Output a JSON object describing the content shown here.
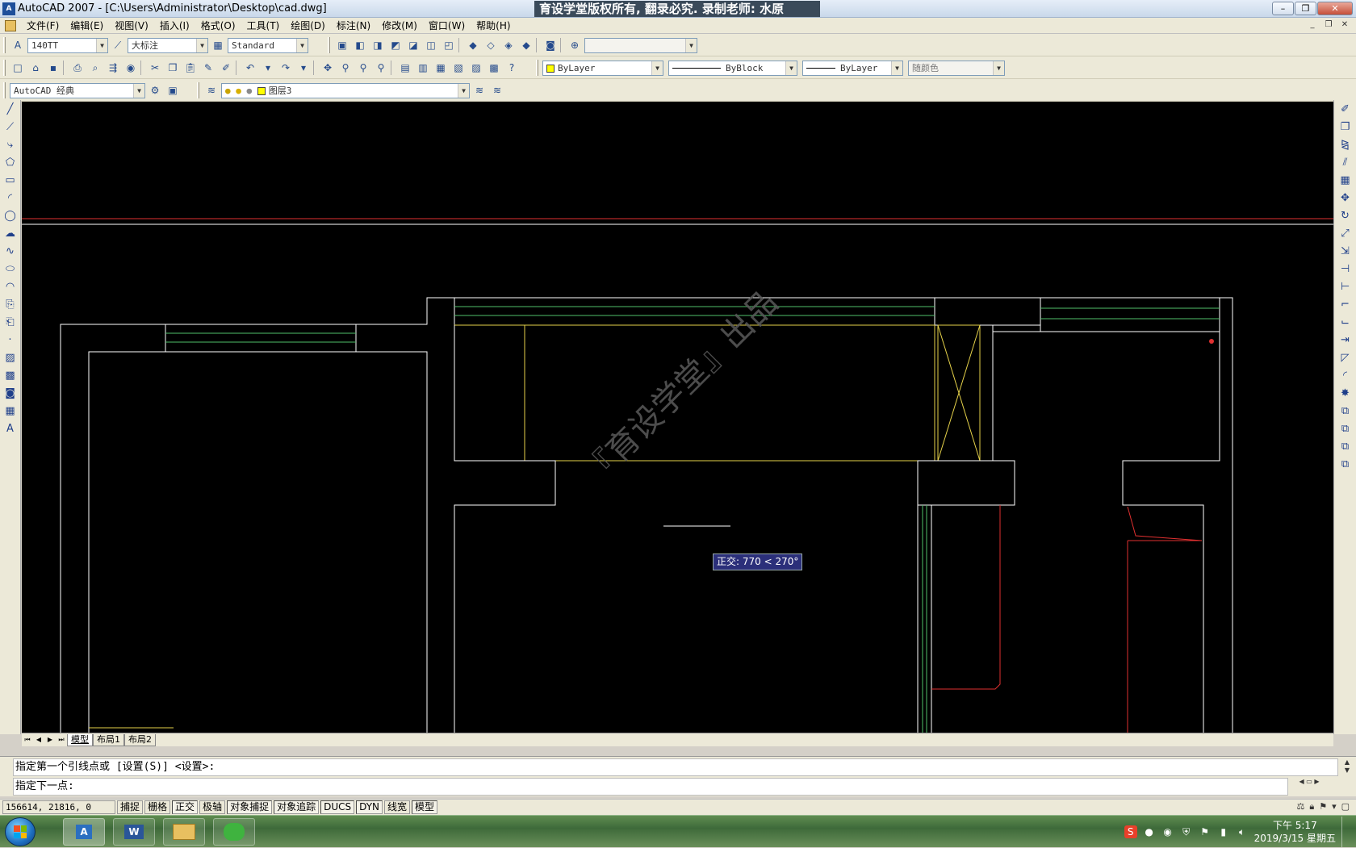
{
  "window": {
    "title": "AutoCAD 2007 - [C:\\Users\\Administrator\\Desktop\\cad.dwg]",
    "banner": "育设学堂版权所有, 翻录必究. 录制老师: 水原",
    "app_icon": "A"
  },
  "menu": [
    "文件(F)",
    "编辑(E)",
    "视图(V)",
    "插入(I)",
    "格式(O)",
    "工具(T)",
    "绘图(D)",
    "标注(N)",
    "修改(M)",
    "窗口(W)",
    "帮助(H)"
  ],
  "toolbar1": {
    "text_style": "140TT",
    "dim_style": "大标注",
    "table_style": "Standard",
    "named_view": ""
  },
  "toolbar2": {
    "color": "ByLayer",
    "linetype": "ByBlock",
    "lineweight": "ByLayer",
    "plotstyle": "随颜色"
  },
  "toolbar3": {
    "workspace": "AutoCAD 经典",
    "layer": "图层3"
  },
  "drawing": {
    "tooltip": "正交: 770 < 270°",
    "watermark": "『育设学堂』出品"
  },
  "layout_tabs": [
    "模型",
    "布局1",
    "布局2"
  ],
  "command": {
    "history": "指定第一个引线点或 [设置(S)] <设置>:",
    "prompt": "指定下一点:"
  },
  "status": {
    "coords": "156614, 21816, 0",
    "toggles": [
      {
        "label": "捕捉",
        "on": false
      },
      {
        "label": "栅格",
        "on": false
      },
      {
        "label": "正交",
        "on": true
      },
      {
        "label": "极轴",
        "on": false
      },
      {
        "label": "对象捕捉",
        "on": true
      },
      {
        "label": "对象追踪",
        "on": true
      },
      {
        "label": "DUCS",
        "on": true
      },
      {
        "label": "DYN",
        "on": true
      },
      {
        "label": "线宽",
        "on": false
      },
      {
        "label": "模型",
        "on": true
      }
    ]
  },
  "taskbar": {
    "time": "下午 5:17",
    "date": "2019/3/15 星期五"
  },
  "colors": {
    "canvas": "#000000",
    "white_line": "#ffffff",
    "yellow_line": "#e6d24a",
    "green_line": "#4fbf6a",
    "red_line": "#e03030"
  }
}
